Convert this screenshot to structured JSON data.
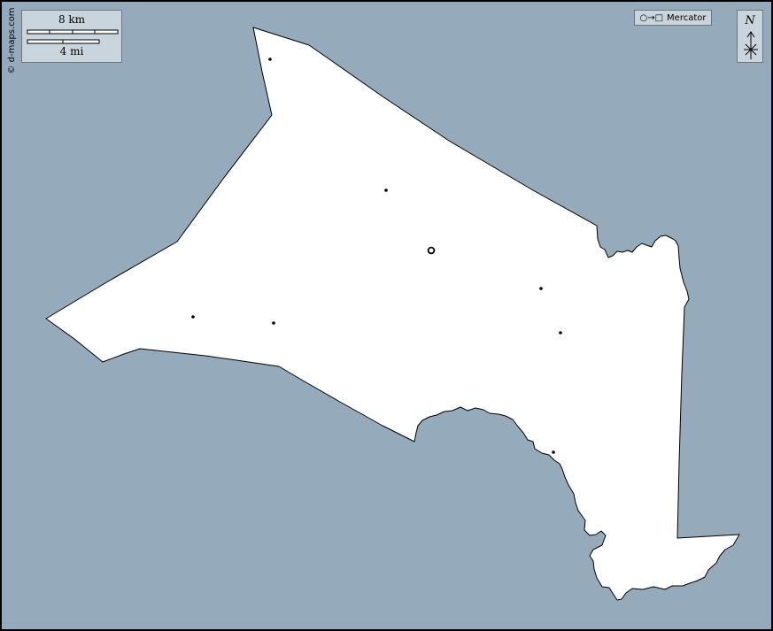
{
  "map": {
    "ocean_color": "#95abbb",
    "land_color": "#ffffff",
    "coastline_color": "#000000",
    "panel_color": "#c9d4dc"
  },
  "scale": {
    "km_label": "8 km",
    "mi_label": "4 mi"
  },
  "credit": {
    "text": "© d-maps.com"
  },
  "projection": {
    "label": "Mercator",
    "icon_glyph": "○→□"
  },
  "compass": {
    "north_label": "N"
  },
  "places": {
    "capital_marker": "capital-ring",
    "town_marker": "town-dot",
    "town_count_shown": 8
  }
}
